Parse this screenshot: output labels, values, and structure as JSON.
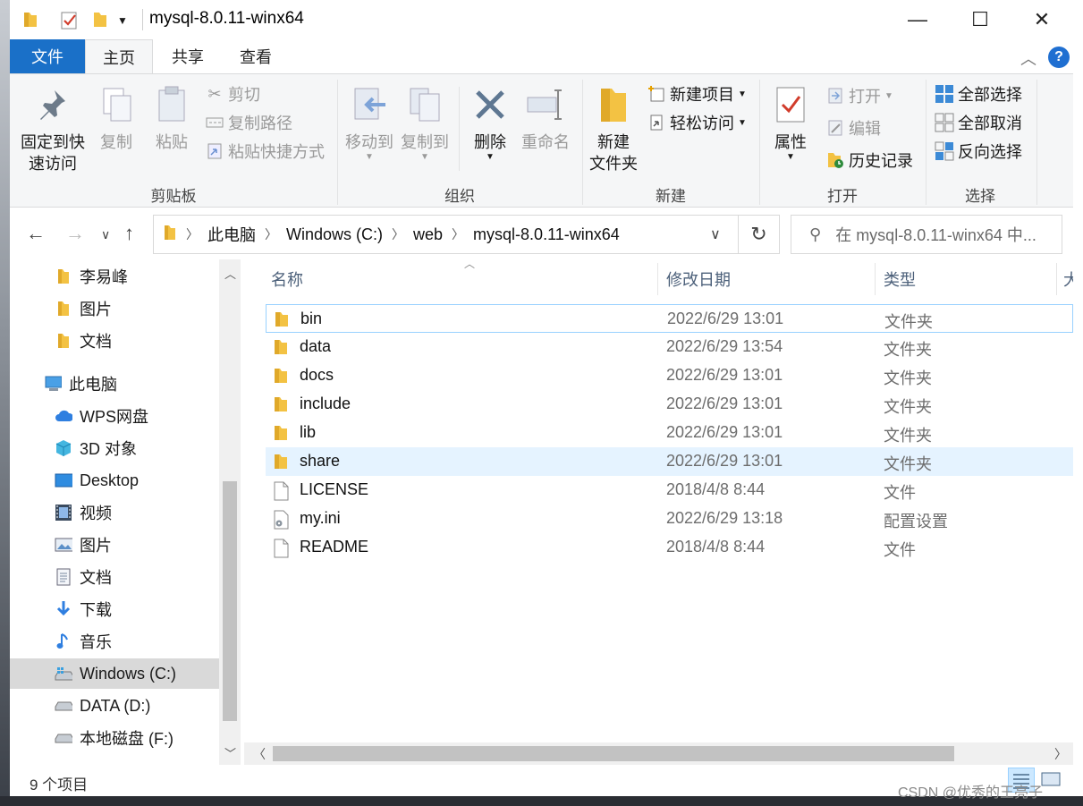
{
  "window": {
    "title": "mysql-8.0.11-winx64",
    "minimize": "—",
    "maximize": "☐",
    "close": "✕"
  },
  "tabs": [
    {
      "label": "文件"
    },
    {
      "label": "主页"
    },
    {
      "label": "共享"
    },
    {
      "label": "查看"
    }
  ],
  "ribbon": {
    "clipboard": {
      "group": "剪贴板",
      "pin": "固定到快\n速访问",
      "copy": "复制",
      "paste": "粘贴",
      "cut": "剪切",
      "copy_path": "复制路径",
      "paste_shortcut": "粘贴快捷方式"
    },
    "organize": {
      "group": "组织",
      "move_to": "移动到",
      "copy_to": "复制到",
      "delete": "删除",
      "rename": "重命名"
    },
    "new": {
      "group": "新建",
      "new_folder": "新建\n文件夹",
      "new_item": "新建项目",
      "easy_access": "轻松访问"
    },
    "open": {
      "group": "打开",
      "properties": "属性",
      "open": "打开",
      "edit": "编辑",
      "history": "历史记录"
    },
    "select": {
      "group": "选择",
      "select_all": "全部选择",
      "select_none": "全部取消",
      "invert": "反向选择"
    }
  },
  "address": {
    "crumbs": [
      "此电脑",
      "Windows (C:)",
      "web",
      "mysql-8.0.11-winx64"
    ],
    "search_placeholder": "在 mysql-8.0.11-winx64 中..."
  },
  "nav": [
    {
      "label": "李易峰",
      "icon": "folder-icon"
    },
    {
      "label": "图片",
      "icon": "folder-icon"
    },
    {
      "label": "文档",
      "icon": "folder-icon"
    },
    {
      "label": "此电脑",
      "icon": "computer-icon"
    },
    {
      "label": "WPS网盘",
      "icon": "cloud-icon"
    },
    {
      "label": "3D 对象",
      "icon": "cube-icon"
    },
    {
      "label": "Desktop",
      "icon": "desktop-icon"
    },
    {
      "label": "视频",
      "icon": "video-icon"
    },
    {
      "label": "图片",
      "icon": "pictures-icon"
    },
    {
      "label": "文档",
      "icon": "documents-icon"
    },
    {
      "label": "下载",
      "icon": "download-icon"
    },
    {
      "label": "音乐",
      "icon": "music-icon"
    },
    {
      "label": "Windows (C:)",
      "icon": "drive-c-icon"
    },
    {
      "label": "DATA (D:)",
      "icon": "drive-icon"
    },
    {
      "label": "本地磁盘 (F:)",
      "icon": "drive-icon"
    }
  ],
  "columns": {
    "name": "名称",
    "date": "修改日期",
    "type": "类型",
    "size": "大"
  },
  "files": [
    {
      "name": "bin",
      "date": "2022/6/29 13:01",
      "type": "文件夹",
      "icon": "folder-icon"
    },
    {
      "name": "data",
      "date": "2022/6/29 13:54",
      "type": "文件夹",
      "icon": "folder-icon"
    },
    {
      "name": "docs",
      "date": "2022/6/29 13:01",
      "type": "文件夹",
      "icon": "folder-icon"
    },
    {
      "name": "include",
      "date": "2022/6/29 13:01",
      "type": "文件夹",
      "icon": "folder-icon"
    },
    {
      "name": "lib",
      "date": "2022/6/29 13:01",
      "type": "文件夹",
      "icon": "folder-icon"
    },
    {
      "name": "share",
      "date": "2022/6/29 13:01",
      "type": "文件夹",
      "icon": "folder-icon"
    },
    {
      "name": "LICENSE",
      "date": "2018/4/8 8:44",
      "type": "文件",
      "icon": "file-icon"
    },
    {
      "name": "my.ini",
      "date": "2022/6/29 13:18",
      "type": "配置设置",
      "icon": "config-file-icon"
    },
    {
      "name": "README",
      "date": "2018/4/8 8:44",
      "type": "文件",
      "icon": "file-icon"
    }
  ],
  "status": {
    "count": "9 个项目"
  },
  "watermark": "CSDN @优秀的王亮子",
  "colors": {
    "accent": "#1a70c8",
    "folder": "#f3c243",
    "hover": "#e5f3ff",
    "focus": "#99d1ff"
  }
}
